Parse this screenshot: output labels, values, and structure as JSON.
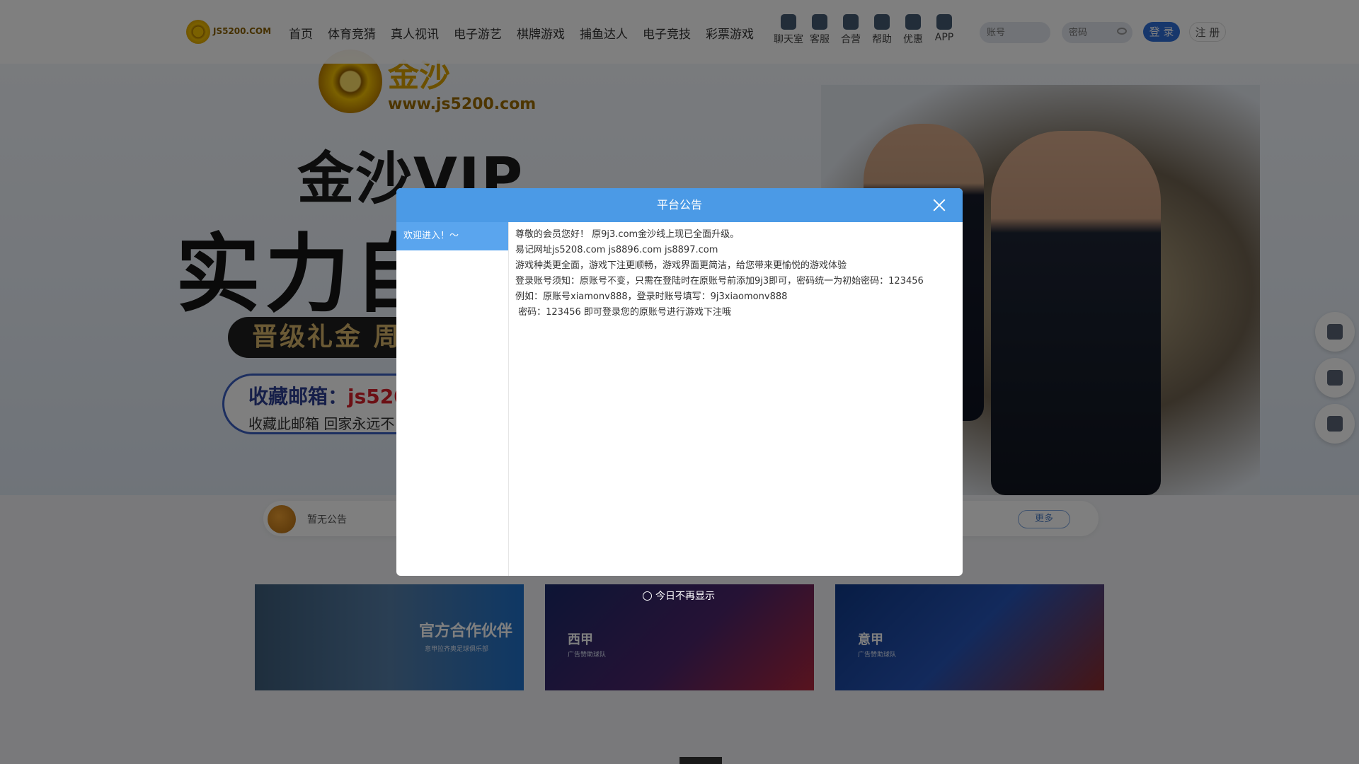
{
  "nav": {
    "logo_text": "JS5200.COM",
    "links": [
      "首页",
      "体育竞猜",
      "真人视讯",
      "电子游艺",
      "棋牌游戏",
      "捕鱼达人",
      "电子竞技",
      "彩票游戏"
    ],
    "icons": [
      {
        "label": "聊天室",
        "icon": "chat-icon"
      },
      {
        "label": "客服",
        "icon": "support-icon"
      },
      {
        "label": "合营",
        "icon": "partner-icon"
      },
      {
        "label": "帮助",
        "icon": "help-icon"
      },
      {
        "label": "优惠",
        "icon": "gift-icon"
      },
      {
        "label": "APP",
        "icon": "phone-icon"
      }
    ],
    "username_placeholder": "账号",
    "password_placeholder": "密码",
    "login_label": "登 录",
    "register_label": "注 册"
  },
  "banner": {
    "brand_cn": "金沙",
    "brand_url": "www.js5200.com",
    "vip_title": "金沙VIP",
    "strength": "实力自",
    "pill_text": "晋级礼金 周",
    "mail_label": "收藏邮箱：",
    "mail_value": "js520",
    "mail_sub": "收藏此邮箱 回家永远不"
  },
  "notice": {
    "text": "暂无公告",
    "more_label": "更多"
  },
  "cards": [
    {
      "name": "官方合作伙伴",
      "sub": "意甲拉齐奥足球俱乐部"
    },
    {
      "name": "西甲",
      "sub": "广告赞助球队"
    },
    {
      "name": "意甲",
      "sub": "广告赞助球队"
    }
  ],
  "modal": {
    "title": "平台公告",
    "side_tab": "欢迎进入！～",
    "lines": [
      "尊敬的会员您好！ 原9j3.com金沙线上现已全面升级。",
      "易记网址js5208.com  js8896.com   js8897.com",
      "游戏种类更全面，游戏下注更顺畅，游戏界面更简洁，给您带来更愉悦的游戏体验",
      "登录账号须知：原账号不变，只需在登陆时在原账号前添加9j3即可，密码统一为初始密码：123456",
      "例如：原账号xiamonv888，登录时账号填写：9j3xiaomonv888",
      " 密码：123456 即可登录您的原账号进行游戏下注哦"
    ],
    "no_show_label": "今日不再显示"
  },
  "colors": {
    "modal_header": "#4b9ae6",
    "side_tab_active": "#5aa5ee",
    "login_button": "#2f6fd8"
  }
}
